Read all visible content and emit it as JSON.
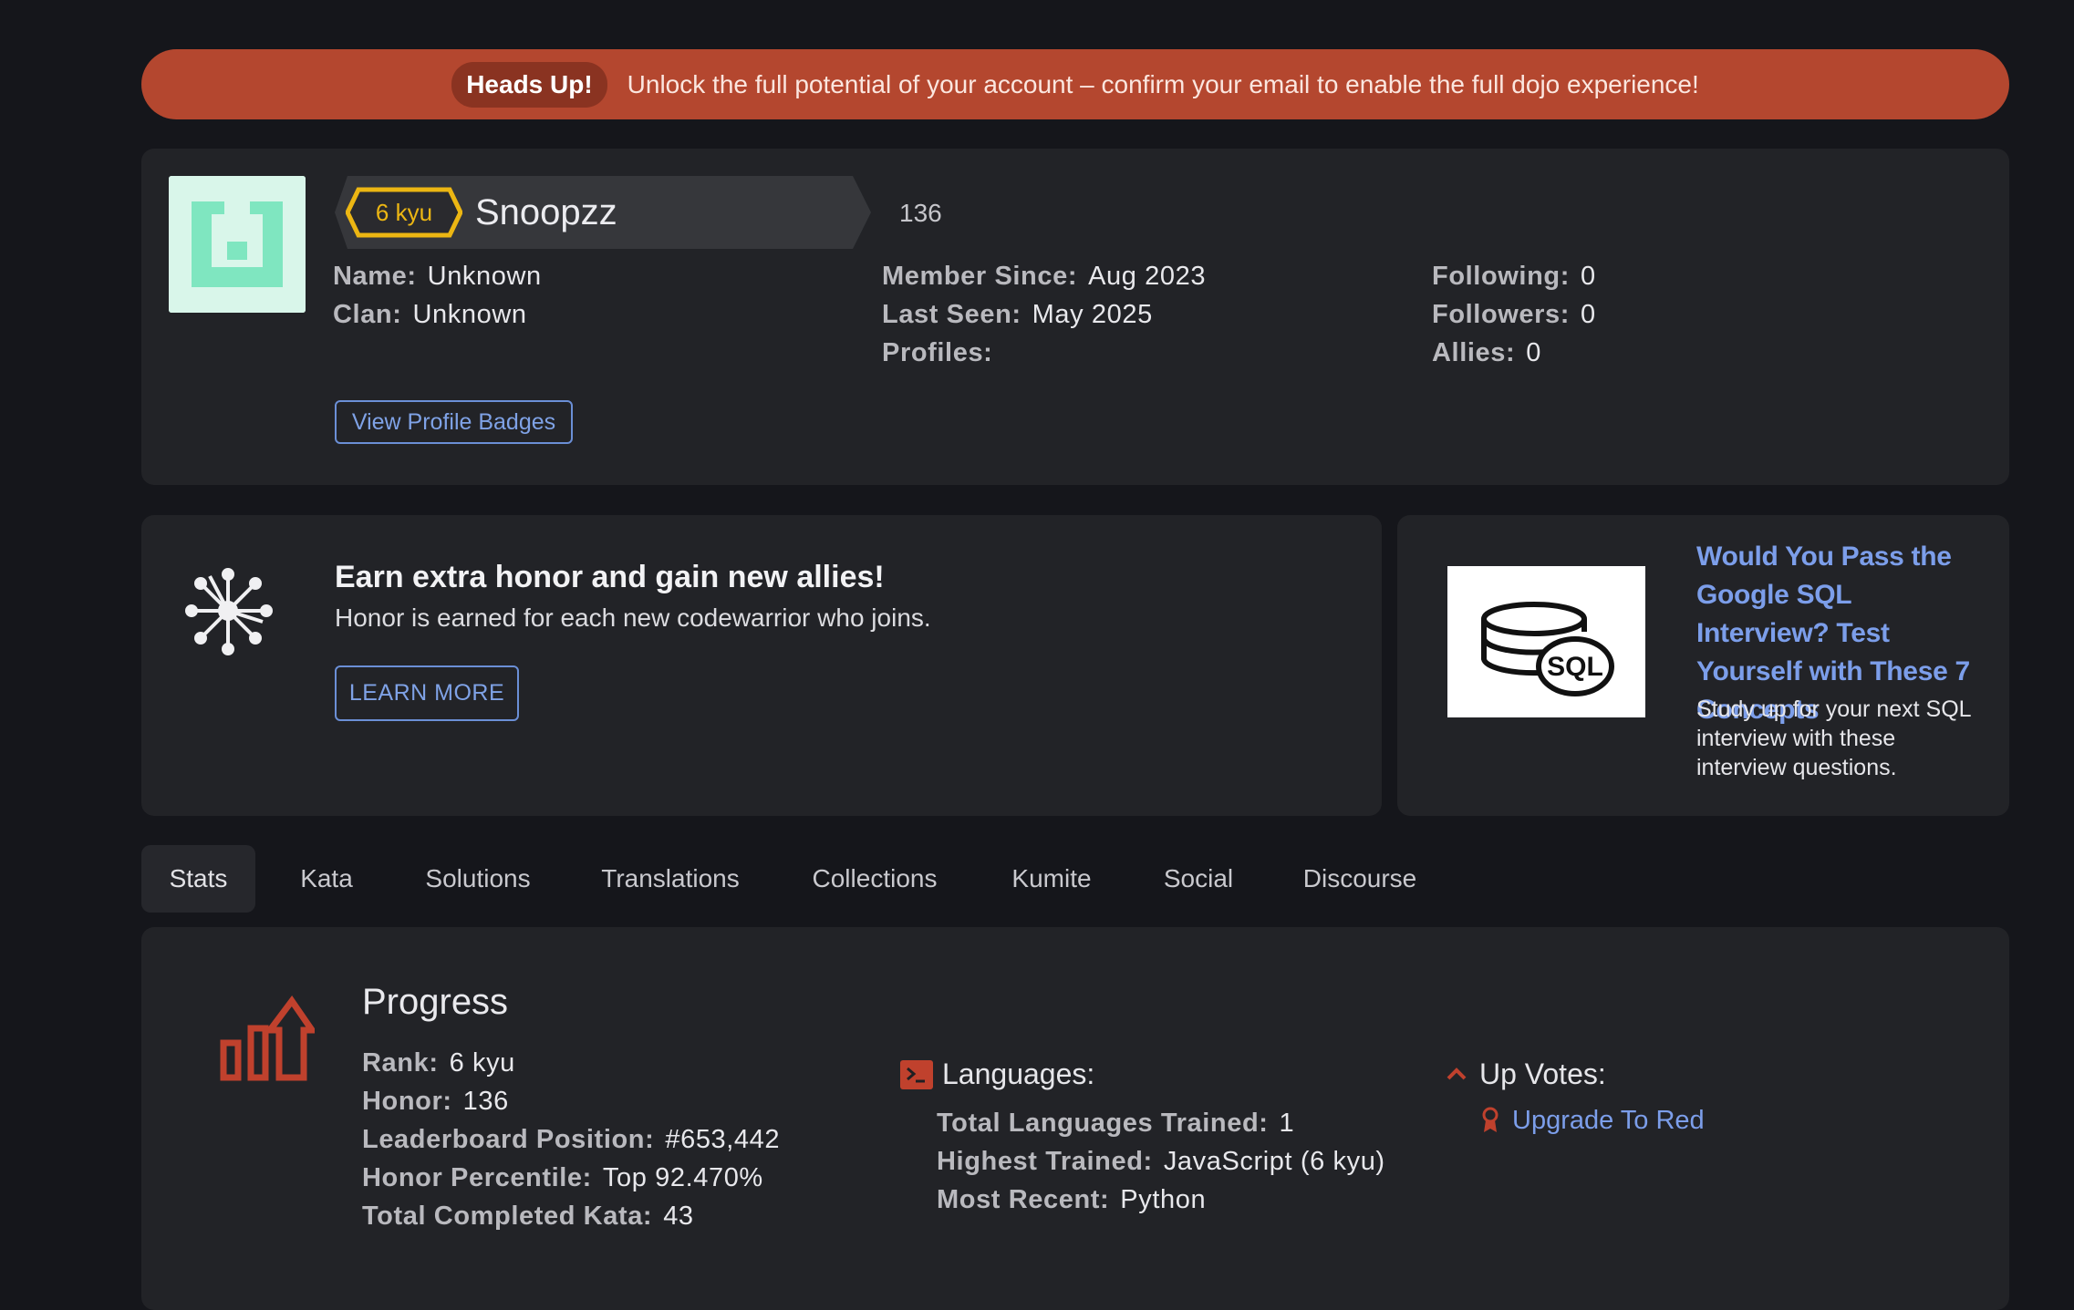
{
  "banner": {
    "pill": "Heads Up!",
    "message": "Unlock the full potential of your account – confirm your email to enable the full dojo experience!"
  },
  "profile": {
    "rank": "6 kyu",
    "username": "Snoopzz",
    "honor": "136",
    "col1": [
      {
        "label": "Name:",
        "value": "Unknown"
      },
      {
        "label": "Clan:",
        "value": "Unknown"
      }
    ],
    "col2": [
      {
        "label": "Member Since:",
        "value": "Aug 2023"
      },
      {
        "label": "Last Seen:",
        "value": "May 2025"
      },
      {
        "label": "Profiles:",
        "value": ""
      }
    ],
    "col3": [
      {
        "label": "Following:",
        "value": "0"
      },
      {
        "label": "Followers:",
        "value": "0"
      },
      {
        "label": "Allies:",
        "value": "0"
      }
    ],
    "badges_button": "View Profile Badges"
  },
  "referral": {
    "title": "Earn extra honor and gain new allies!",
    "subtitle": "Honor is earned for each new codewarrior who joins.",
    "button": "LEARN MORE"
  },
  "ad": {
    "image_label": "SQL",
    "title": "Would You Pass the Google SQL Interview? Test Yourself with These 7 Concepts",
    "description": "Study up for your next SQL interview with these interview questions."
  },
  "tabs": [
    "Stats",
    "Kata",
    "Solutions",
    "Translations",
    "Collections",
    "Kumite",
    "Social",
    "Discourse"
  ],
  "active_tab": "Stats",
  "stats": {
    "progress_title": "Progress",
    "progress": [
      {
        "label": "Rank:",
        "value": "6 kyu"
      },
      {
        "label": "Honor:",
        "value": "136"
      },
      {
        "label": "Leaderboard Position:",
        "value": "#653,442"
      },
      {
        "label": "Honor Percentile:",
        "value": "Top 92.470%"
      },
      {
        "label": "Total Completed Kata:",
        "value": "43"
      }
    ],
    "languages_title": "Languages:",
    "languages": [
      {
        "label": "Total Languages Trained:",
        "value": "1"
      },
      {
        "label": "Highest Trained:",
        "value": "JavaScript (6 kyu)"
      },
      {
        "label": "Most Recent:",
        "value": "Python"
      }
    ],
    "upvotes_title": "Up Votes:",
    "upvotes_link": "Upgrade To Red"
  },
  "colors": {
    "background": "#15161b",
    "card": "#222327",
    "banner": "#b4472f",
    "accent_red": "#c0412d",
    "link_blue": "#7c9eea",
    "rank_yellow": "#ecb613"
  }
}
